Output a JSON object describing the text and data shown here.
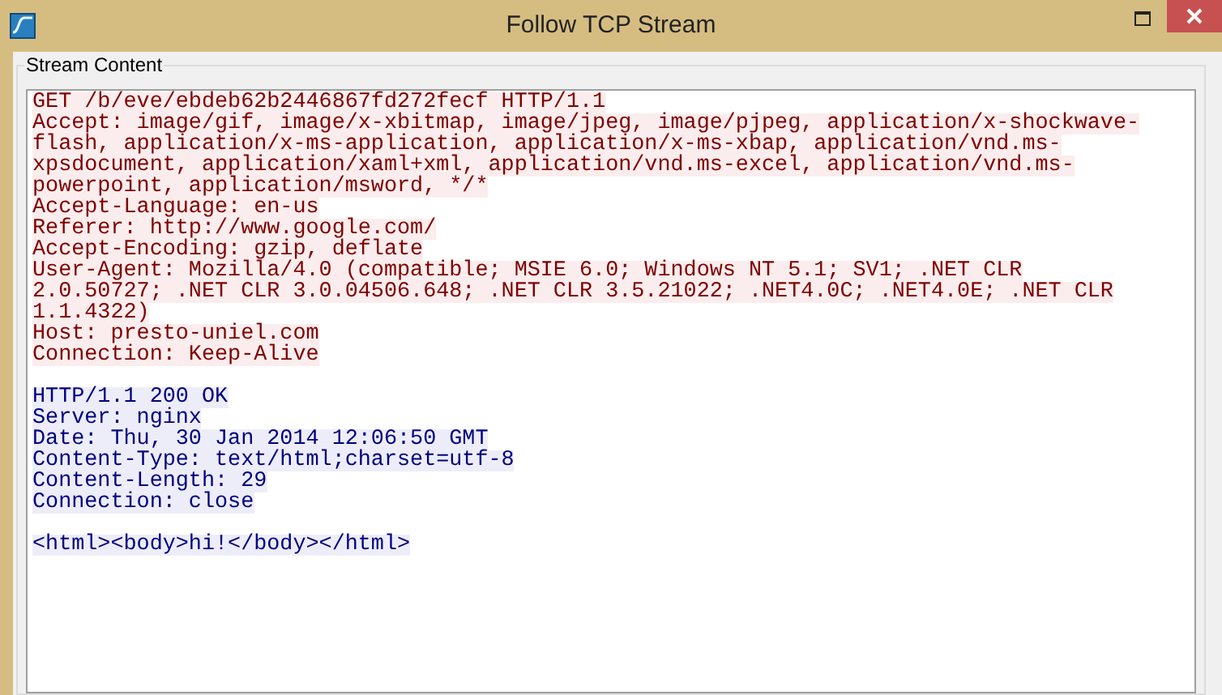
{
  "window": {
    "title": "Follow TCP Stream"
  },
  "group": {
    "label": "Stream Content"
  },
  "segments": [
    {
      "kind": "client",
      "lines": [
        "GET /b/eve/ebdeb62b2446867fd272fecf HTTP/1.1",
        "Accept: image/gif, image/x-xbitmap, image/jpeg, image/pjpeg, application/x-shockwave-",
        "flash, application/x-ms-application, application/x-ms-xbap, application/vnd.ms-",
        "xpsdocument, application/xaml+xml, application/vnd.ms-excel, application/vnd.ms-",
        "powerpoint, application/msword, */*",
        "Accept-Language: en-us",
        "Referer: http://www.google.com/",
        "Accept-Encoding: gzip, deflate",
        "User-Agent: Mozilla/4.0 (compatible; MSIE 6.0; Windows NT 5.1; SV1; .NET CLR",
        "2.0.50727; .NET CLR 3.0.04506.648; .NET CLR 3.5.21022; .NET4.0C; .NET4.0E; .NET CLR",
        "1.1.4322)",
        "Host: presto-uniel.com",
        "Connection: Keep-Alive"
      ]
    },
    {
      "kind": "server",
      "lines": [
        "HTTP/1.1 200 OK",
        "Server: nginx",
        "Date: Thu, 30 Jan 2014 12:06:50 GMT",
        "Content-Type: text/html;charset=utf-8",
        "Content-Length: 29",
        "Connection: close"
      ]
    },
    {
      "kind": "server",
      "lines": [
        "<html><body>hi!</body></html>"
      ]
    }
  ]
}
